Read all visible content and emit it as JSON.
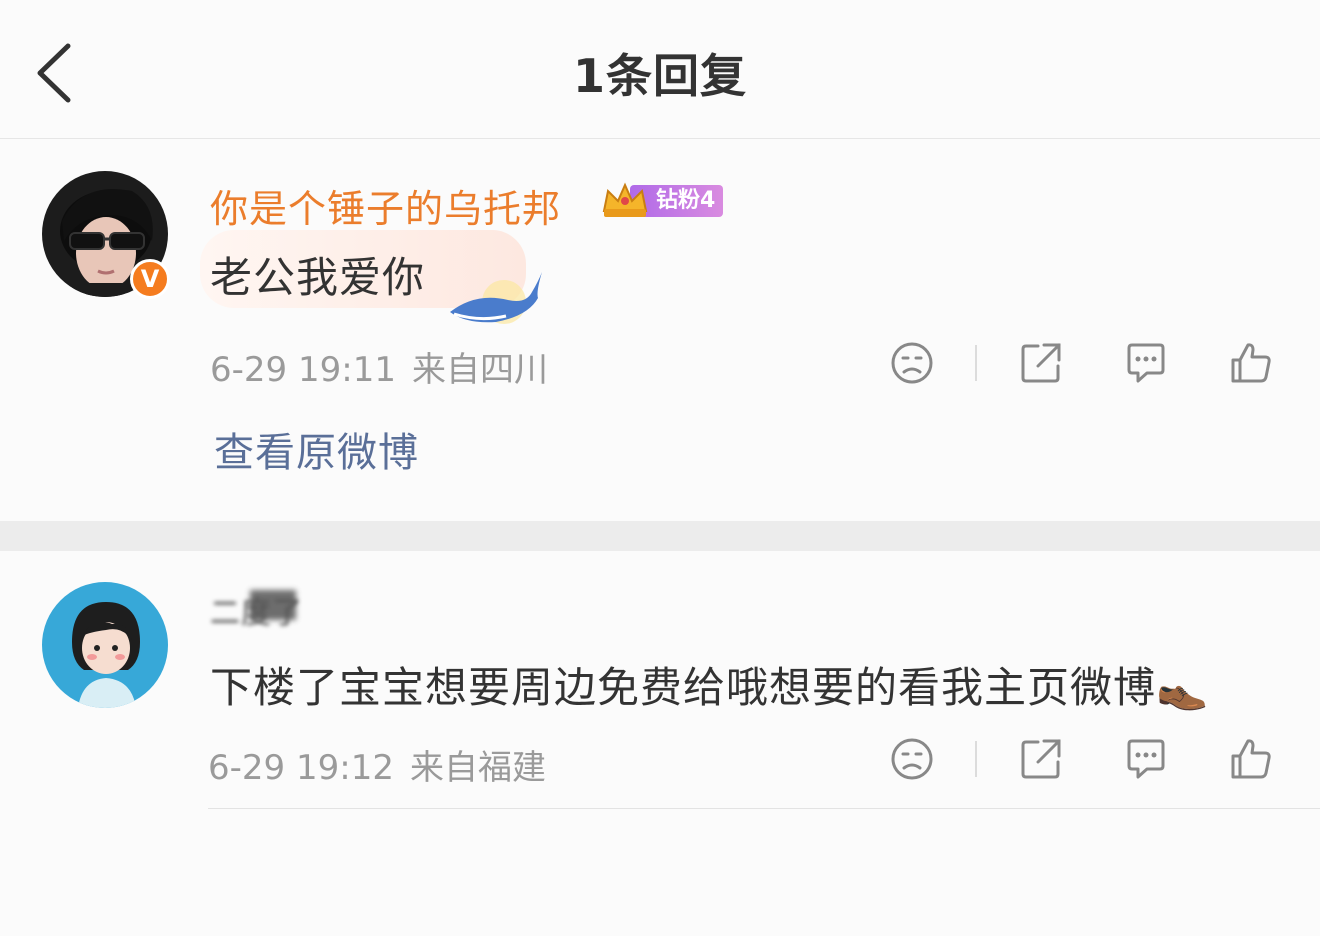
{
  "header": {
    "title": "1条回复",
    "back_icon": "chevron-left-icon"
  },
  "comment_1": {
    "username": "你是个锤子的乌托邦",
    "fan_badge": "钻粉4",
    "text": "老公我爱你",
    "timestamp": "6-29 19:11",
    "location": "来自四川",
    "link_original": "查看原微博",
    "verified_label": "V"
  },
  "comment_2": {
    "username": "二度了",
    "text": "下楼了宝宝想要周边免费给哦想要的看我主页微博👞",
    "timestamp": "6-29 19:12",
    "location": "来自福建"
  },
  "colors": {
    "username_orange": "#eb7d2c",
    "link_blue": "#5a6f98",
    "meta_gray": "#9a9a9a",
    "badge_purple": "#b06ae8",
    "verified_orange": "#f57c1f"
  }
}
